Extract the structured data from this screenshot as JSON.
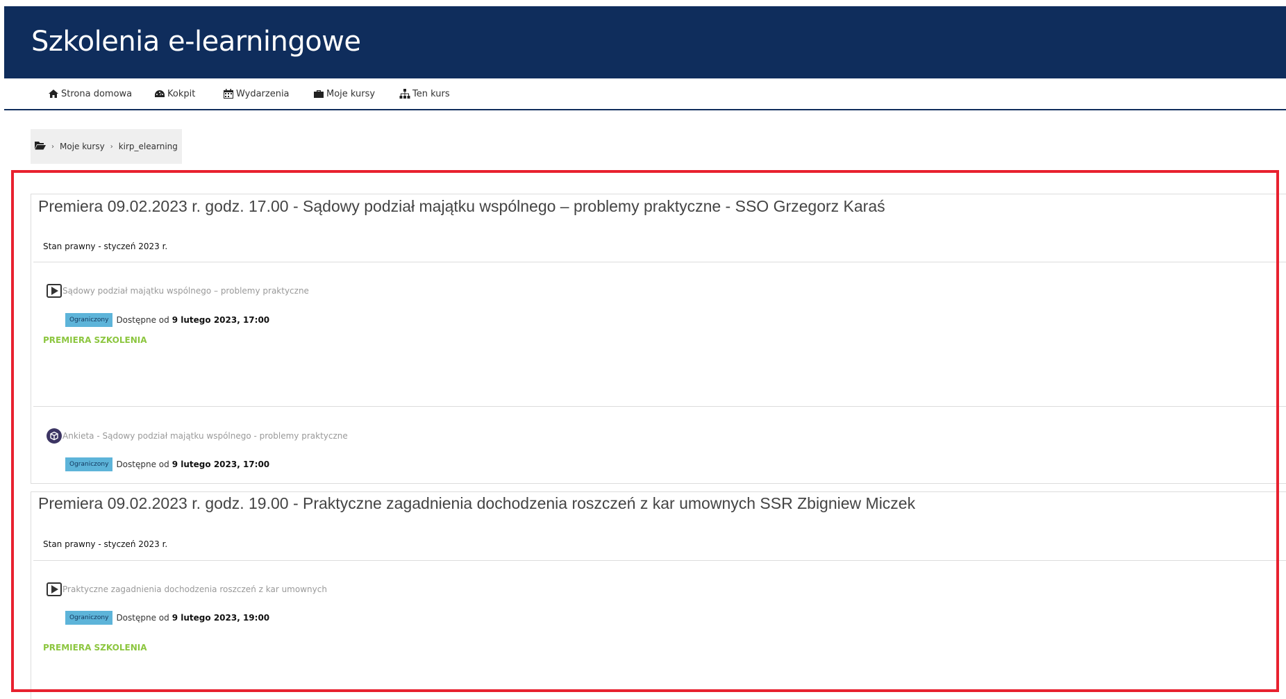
{
  "header": {
    "title": "Szkolenia e-learningowe"
  },
  "nav": {
    "home": "Strona domowa",
    "dashboard": "Kokpit",
    "events": "Wydarzenia",
    "my_courses": "Moje kursy",
    "this_course": "Ten kurs"
  },
  "breadcrumb": {
    "item1": "Moje kursy",
    "item2": "kirp_elearning"
  },
  "sections": [
    {
      "title": "Premiera 09.02.2023 r. godz. 17.00 - Sądowy podział majątku wspólnego – problemy praktyczne - SSO Grzegorz Karaś",
      "summary": "Stan prawny - styczeń 2023 r.",
      "activities": [
        {
          "name": "Sądowy podział majątku wspólnego – problemy praktyczne",
          "badge": "Ograniczony",
          "available_prefix": "Dostępne od",
          "available_date": "9 lutego 2023, 17:00",
          "premiere_label": "PREMIERA SZKOLENIA"
        },
        {
          "name": "Ankieta - Sądowy podział majątku wspólnego - problemy praktyczne",
          "badge": "Ograniczony",
          "available_prefix": "Dostępne od",
          "available_date": "9 lutego 2023, 17:00"
        }
      ]
    },
    {
      "title": "Premiera 09.02.2023 r. godz. 19.00 - Praktyczne zagadnienia dochodzenia roszczeń z kar umownych SSR Zbigniew Miczek",
      "summary": "Stan prawny - styczeń 2023 r.",
      "activities": [
        {
          "name": "Praktyczne zagadnienia dochodzenia roszczeń z kar umownych",
          "badge": "Ograniczony",
          "available_prefix": "Dostępne od",
          "available_date": "9 lutego 2023, 19:00",
          "premiere_label": "PREMIERA SZKOLENIA"
        }
      ]
    }
  ],
  "colors": {
    "header_bg": "#0f2d5c",
    "highlight_border": "#e8212f",
    "badge_bg": "#5db4d9",
    "premiere_text": "#8cc63f"
  }
}
